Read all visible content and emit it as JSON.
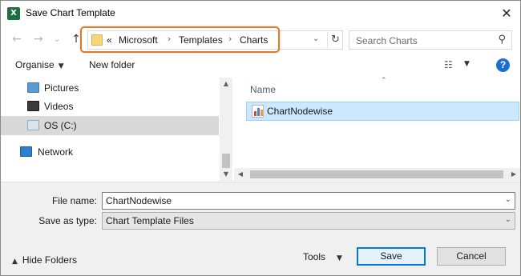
{
  "window": {
    "title": "Save Chart Template",
    "app_icon_letter": "X",
    "close_glyph": "✕"
  },
  "nav": {
    "back_glyph": "←",
    "forward_glyph": "→",
    "recent_glyph": "⌄",
    "up_glyph": "↑",
    "address": {
      "overflow": "«",
      "crumbs": [
        "Microsoft",
        "Templates",
        "Charts"
      ],
      "separator": "›",
      "dropdown_glyph": "⌄",
      "refresh_glyph": "↻"
    },
    "search": {
      "placeholder": "Search Charts",
      "icon_glyph": "⚲"
    }
  },
  "toolbar": {
    "organise_label": "Organise",
    "new_folder_label": "New folder",
    "caret_glyph": "▼",
    "view_glyph": "☷",
    "help_glyph": "?"
  },
  "sidebar": {
    "items": [
      {
        "label": "Pictures",
        "icon": "pictures-icon",
        "color": "#5b9bd5"
      },
      {
        "label": "Videos",
        "icon": "videos-icon",
        "color": "#3a3a3a"
      },
      {
        "label": "OS (C:)",
        "icon": "drive-icon",
        "color": "#8fa9c4",
        "selected": true
      },
      {
        "label": "Network",
        "icon": "network-icon",
        "color": "#2f7fd0"
      }
    ],
    "scroll_up_glyph": "▲",
    "scroll_down_glyph": "▼"
  },
  "file_list": {
    "column_header": "Name",
    "sort_glyph": "⌃",
    "files": [
      {
        "name": "ChartNodewise",
        "selected": true
      }
    ],
    "scroll_left_glyph": "◀",
    "scroll_right_glyph": "▶"
  },
  "form": {
    "file_name_label": "File name:",
    "file_name_value": "ChartNodewise",
    "save_type_label": "Save as type:",
    "save_type_value": "Chart Template Files",
    "dropdown_glyph": "⌄"
  },
  "footer": {
    "hide_folders_label": "Hide Folders",
    "hide_caret_glyph": "▲",
    "tools_label": "Tools",
    "tools_caret_glyph": "▼",
    "save_label": "Save",
    "cancel_label": "Cancel"
  },
  "colors": {
    "accent": "#0078d7",
    "highlight_outline": "#e0782f",
    "selection": "#cce8ff",
    "excel_green": "#1d6f42"
  }
}
